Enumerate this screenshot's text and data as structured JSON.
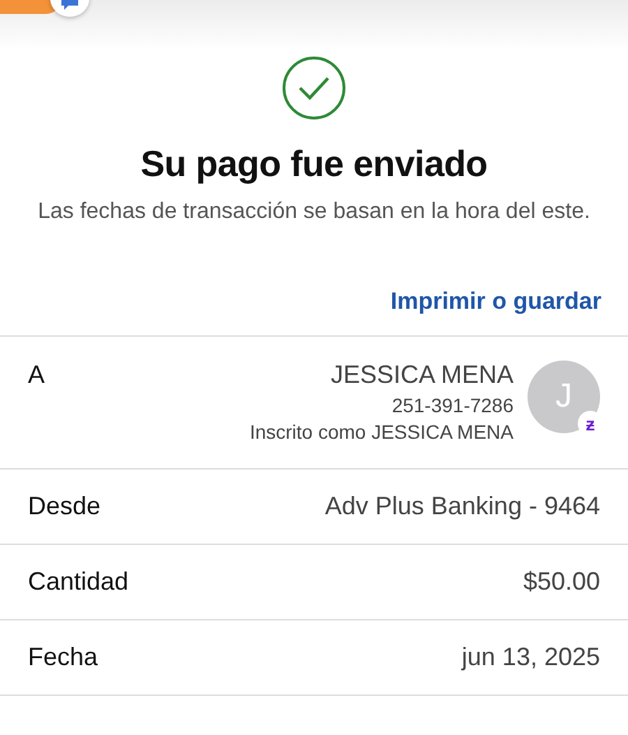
{
  "header": {
    "title": "Su pago fue enviado",
    "subtitle": "Las fechas de transacción se basan en la hora del este."
  },
  "print_link": "Imprimir o guardar",
  "recipient": {
    "label": "A",
    "name": "JESSICA MENA",
    "phone": "251-391-7286",
    "enrolled": "Inscrito como JESSICA MENA",
    "avatar_initial": "J",
    "badge": "ƶ"
  },
  "details": [
    {
      "label": "Desde",
      "value": "Adv Plus Banking - 9464"
    },
    {
      "label": "Cantidad",
      "value": "$50.00"
    },
    {
      "label": "Fecha",
      "value": "jun 13, 2025"
    }
  ]
}
